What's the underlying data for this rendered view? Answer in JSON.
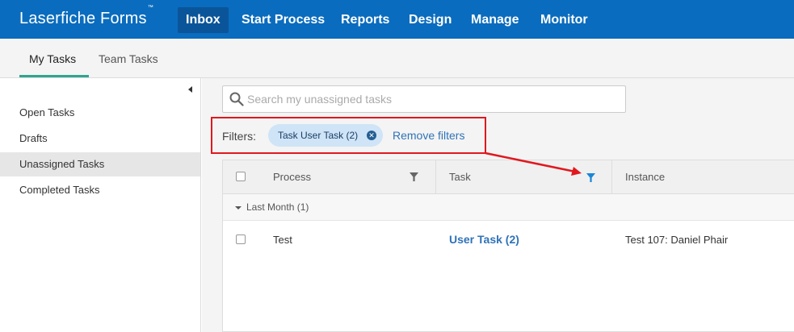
{
  "app": {
    "brand": "Laserfiche Forms",
    "trademark": "™"
  },
  "nav": {
    "items": [
      {
        "label": "Inbox",
        "active": true
      },
      {
        "label": "Start Process"
      },
      {
        "label": "Reports"
      },
      {
        "label": "Design"
      },
      {
        "label": "Manage"
      },
      {
        "label": "Monitor"
      }
    ]
  },
  "subtabs": [
    {
      "label": "My Tasks",
      "active": true
    },
    {
      "label": "Team Tasks"
    }
  ],
  "sidebar": {
    "items": [
      {
        "label": "Open Tasks"
      },
      {
        "label": "Drafts"
      },
      {
        "label": "Unassigned Tasks",
        "active": true
      },
      {
        "label": "Completed Tasks"
      }
    ]
  },
  "search": {
    "placeholder": "Search my unassigned tasks",
    "value": ""
  },
  "filters": {
    "label": "Filters:",
    "chips": [
      {
        "label": "Task User Task (2)"
      }
    ],
    "remove_label": "Remove filters"
  },
  "table": {
    "columns": [
      {
        "label": "Process",
        "filter_active": false
      },
      {
        "label": "Task",
        "filter_active": true
      },
      {
        "label": "Instance"
      }
    ],
    "groups": [
      {
        "label": "Last Month (1)",
        "rows": [
          {
            "process": "Test",
            "task": "User Task (2)",
            "instance": "Test 107: Daniel Phair"
          }
        ]
      }
    ]
  },
  "colors": {
    "nav_bg": "#0a6cbe",
    "nav_active": "#0a5599",
    "accent_underline": "#2ea58f",
    "link": "#2f72b9",
    "annotation_red": "#e0181e",
    "active_filter_icon": "#1a86d6"
  }
}
